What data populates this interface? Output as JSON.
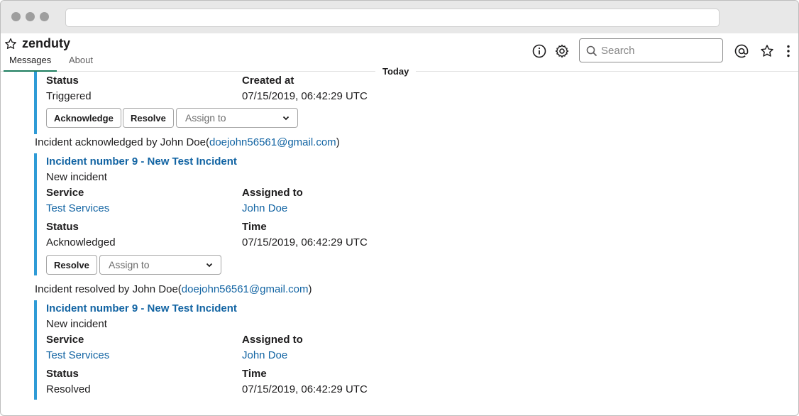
{
  "channel": {
    "name": "zenduty"
  },
  "tabs": [
    {
      "label": "Messages"
    },
    {
      "label": "About"
    }
  ],
  "search": {
    "placeholder": "Search"
  },
  "divider": {
    "label": "Today"
  },
  "top_block": {
    "status_label": "Status",
    "status_value": "Triggered",
    "created_label": "Created at",
    "created_value": "07/15/2019, 06:42:29 UTC",
    "acknowledge_label": "Acknowledge",
    "resolve_label": "Resolve",
    "assign_placeholder": "Assign to"
  },
  "ack_message": {
    "prefix": "Incident acknowledged by John Doe(",
    "email": "doejohn56561@gmail.com",
    "suffix": ")"
  },
  "ack_block": {
    "title": "Incident number 9 - New Test Incident",
    "subtitle": "New incident",
    "service_label": "Service",
    "service_value": "Test Services",
    "assigned_label": "Assigned to",
    "assigned_value": "John Doe",
    "status_label": "Status",
    "status_value": "Acknowledged",
    "time_label": "Time",
    "time_value": "07/15/2019, 06:42:29 UTC",
    "resolve_label": "Resolve",
    "assign_placeholder": "Assign to"
  },
  "resolved_message": {
    "prefix": "Incident resolved by John Doe(",
    "email": "doejohn56561@gmail.com",
    "suffix": ")"
  },
  "resolved_block": {
    "title": "Incident number 9 - New Test Incident",
    "subtitle": "New incident",
    "service_label": "Service",
    "service_value": "Test Services",
    "assigned_label": "Assigned to",
    "assigned_value": "John Doe",
    "status_label": "Status",
    "status_value": "Resolved",
    "time_label": "Time",
    "time_value": "07/15/2019, 06:42:29 UTC"
  },
  "colors": {
    "accent_bar": "#2f9bd6",
    "link": "#1264a3",
    "tab_underline": "#1d7d5e"
  },
  "icons": [
    "star-outline-icon",
    "info-icon",
    "gear-icon",
    "search-icon",
    "mention-icon",
    "star-icon",
    "more-vertical-icon",
    "chevron-down-icon"
  ]
}
